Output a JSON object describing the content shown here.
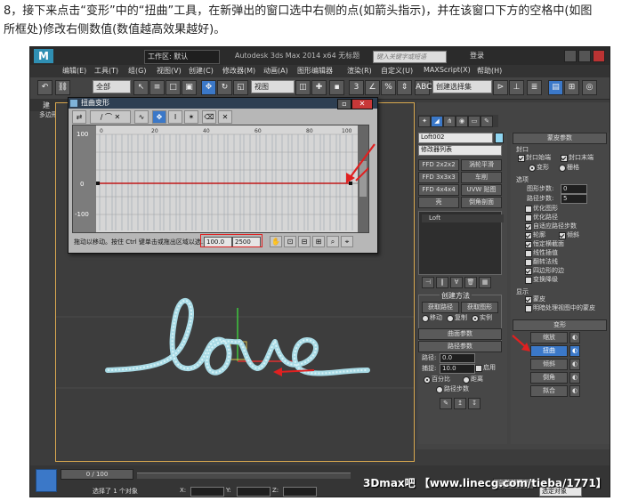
{
  "caption": {
    "line1": "8，接下来点击“变形”中的“扭曲”工具，在新弹出的窗口选中右侧的点(如箭头指示)，并在该窗口下方的空格中(如图",
    "line2": "所框处)修改右侧数值(数值越高效果越好)。"
  },
  "app": {
    "workspace": "工作区: 默认",
    "title": "Autodesk 3ds Max 2014 x64",
    "title_suffix": "无标题",
    "search_placeholder": "键入关键字或短语",
    "login": "登录"
  },
  "menu": [
    "编辑(E)",
    "工具(T)",
    "组(G)",
    "视图(V)",
    "创建(C)",
    "修改器(M)",
    "动画(A)",
    "图形编辑器",
    "渲染(R)",
    "自定义(U)",
    "MAXScript(X)",
    "帮助(H)"
  ],
  "toolbar": {
    "select_filter": "全部",
    "ref_coord": "视图",
    "named_selection": "创建选择集",
    "view_label": "建",
    "viewport_label": "多边形"
  },
  "dialog": {
    "title": "扭曲变形",
    "y_ticks": [
      "100",
      "0",
      "-100"
    ],
    "x_ticks": [
      "0",
      "20",
      "40",
      "60",
      "80",
      "100"
    ],
    "status_text": "拖动以移动。按住 Ctrl 键单击或拖出区域以选...",
    "field1": "100.0",
    "field2": "2500"
  },
  "panel": {
    "object_name": "Loft002",
    "modifier_list": "修改器列表",
    "buttons": [
      "FFD 2x2x2",
      "涡轮平滑",
      "FFD 3x3x3",
      "车削",
      "FFD 4x4x4",
      "UVW 贴图",
      "壳",
      "倒角剖面"
    ],
    "stack_item": "Loft",
    "creation_method": {
      "title": "创建方法",
      "get_path": "获取路径",
      "get_shape": "获取图形",
      "move": "移动",
      "copy": "复制",
      "instance": "实例"
    },
    "surface_params": "曲面参数",
    "path_params": {
      "title": "路径参数",
      "path_label": "路径:",
      "path_value": "0.0",
      "snap_label": "捕捉:",
      "snap_value": "10.0",
      "enable": "启用",
      "percent": "百分比",
      "distance": "距离",
      "path_steps": "路径步数"
    },
    "skin": {
      "title": "蒙皮参数",
      "capping": "封口",
      "cap_start": "封口始端",
      "cap_end": "封口末端",
      "morph": "变形",
      "grid": "栅格",
      "options": "选项",
      "shape_steps_label": "图形步数:",
      "shape_steps": "0",
      "path_steps_label": "路径步数:",
      "path_steps": "5",
      "checks": [
        "优化图形",
        "优化路径",
        "自适应路径步数",
        "轮廓",
        "倾斜",
        "恒定横截面",
        "线性插值",
        "翻转法线",
        "四边形的边",
        "变换降级"
      ],
      "display": "显示",
      "skin_label": "蒙皮",
      "skin_shaded": "明暗处理视图中的蒙皮"
    },
    "deformations": {
      "title": "变形",
      "items": [
        "缩放",
        "扭曲",
        "倾斜",
        "倒角",
        "拟合"
      ]
    }
  },
  "timeline": {
    "frame": "0 / 100",
    "prompt": "选择了 1 个对象",
    "coords": [
      "X:",
      "Y:",
      "Z:"
    ],
    "auto_key": "自动关键点",
    "key_filter": "选定对象"
  },
  "watermark": "3Dmax吧 【www.linecg.com/tieba/1771】",
  "viewport_text": "love",
  "colors": {
    "accent": "#3b78c8",
    "annotation": "#e02020",
    "graph_line": "#c01818"
  }
}
